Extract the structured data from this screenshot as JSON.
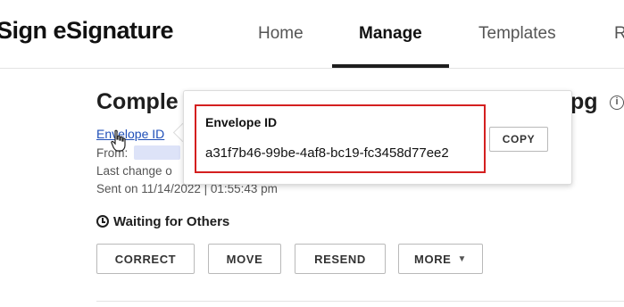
{
  "header": {
    "brand": "Sign eSignature",
    "tabs": [
      {
        "label": "Home"
      },
      {
        "label": "Manage"
      },
      {
        "label": "Templates"
      },
      {
        "label": "R"
      }
    ],
    "active_tab": "Manage"
  },
  "envelope": {
    "title_start": "Comple",
    "title_end": "jpg",
    "envelope_id_link": "Envelope ID",
    "from_label": "From:",
    "last_change": "Last change o",
    "sent": "Sent on 11/14/2022 | 01:55:43 pm",
    "status": "Waiting for Others"
  },
  "actions": {
    "correct": "CORRECT",
    "move": "MOVE",
    "resend": "RESEND",
    "more": "MORE"
  },
  "popover": {
    "label": "Envelope ID",
    "value": "a31f7b46-99be-4af8-bc19-fc3458d77ee2",
    "copy_label": "COPY"
  },
  "colors": {
    "highlight": "#d41f1f",
    "link": "#1f4fb8",
    "active_underline": "#1e1e1e"
  },
  "icons": [
    "info-icon",
    "clock-icon",
    "chevron-down-icon",
    "hand-cursor-icon"
  ]
}
